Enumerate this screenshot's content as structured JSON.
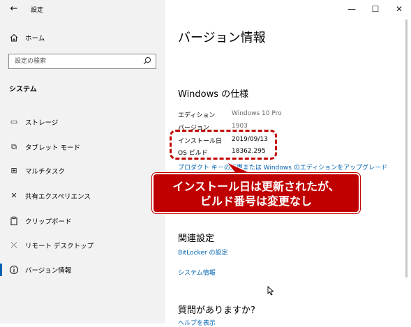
{
  "window": {
    "title": "設定",
    "back_icon": "←",
    "minimize_icon": "—",
    "maximize_icon": "☐",
    "close_icon": "✕"
  },
  "sidebar": {
    "home_label": "ホーム",
    "search_placeholder": "設定の検索",
    "section_heading": "システム",
    "items": [
      {
        "label": "ストレージ",
        "icon": "storage-icon",
        "glyph": "▭"
      },
      {
        "label": "タブレット モード",
        "icon": "tablet-mode-icon",
        "glyph": "⧉"
      },
      {
        "label": "マルチタスク",
        "icon": "multitasking-icon",
        "glyph": "⊞"
      },
      {
        "label": "共有エクスペリエンス",
        "icon": "shared-experiences-icon",
        "glyph": "✕"
      },
      {
        "label": "クリップボード",
        "icon": "clipboard-icon",
        "glyph": "📋"
      },
      {
        "label": "リモート デスクトップ",
        "icon": "remote-desktop-icon",
        "glyph": "⤫"
      },
      {
        "label": "バージョン情報",
        "icon": "info-icon",
        "glyph": "ⓘ"
      }
    ]
  },
  "main": {
    "page_title": "バージョン情報",
    "windows_spec_heading": "Windows の仕様",
    "specs": [
      {
        "label": "エディション",
        "value": "Windows 10 Pro"
      },
      {
        "label": "バージョン",
        "value": "1903"
      },
      {
        "label": "インストール日",
        "value": "2019/09/13"
      },
      {
        "label": "OS ビルド",
        "value": "18362.295"
      }
    ],
    "product_key_link": "プロダクト キーの変更または Windows のエディションをアップグレード",
    "related_heading": "関連設定",
    "bitlocker_link": "BitLocker の設定",
    "system_info_link": "システム情報",
    "question_heading": "質問がありますか?",
    "help_link": "ヘルプを表示"
  },
  "annotation": {
    "line1": "インストール日は更新されたが、",
    "line2": "ビルド番号は変更なし"
  },
  "colors": {
    "accent": "#0063b1",
    "annotation_red": "#c00000",
    "sidebar_bg": "#f2f2f2"
  }
}
